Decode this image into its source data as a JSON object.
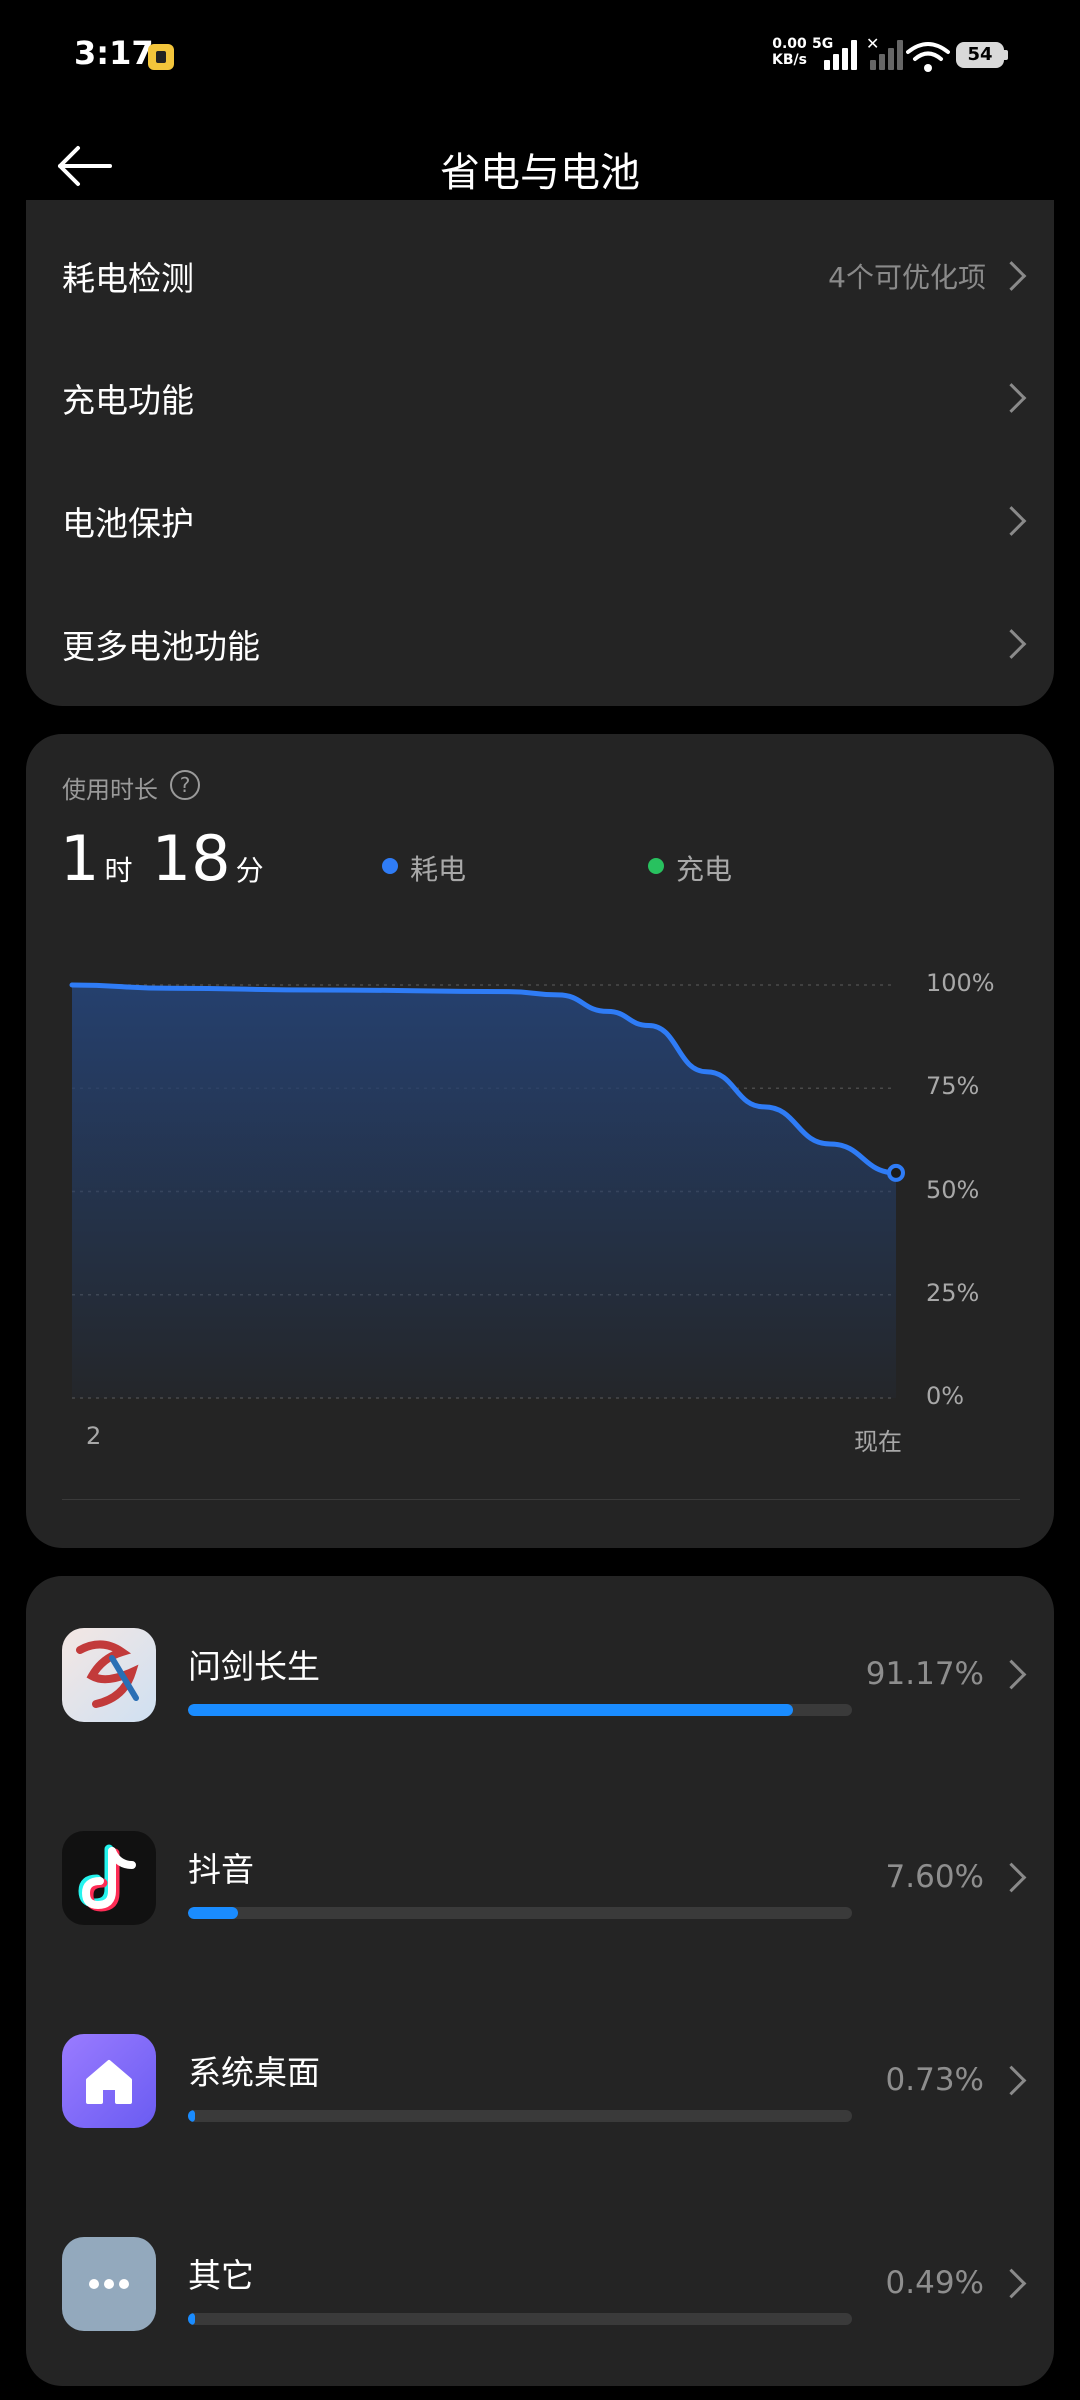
{
  "status": {
    "time": "3:17",
    "net_speed_value": "0.00",
    "net_speed_unit": "KB/s",
    "network_type": "5G",
    "battery_level": "54"
  },
  "header": {
    "title": "省电与电池"
  },
  "menu": {
    "items": [
      {
        "label": "耗电检测",
        "value": "4个可优化项"
      },
      {
        "label": "充电功能",
        "value": ""
      },
      {
        "label": "电池保护",
        "value": ""
      },
      {
        "label": "更多电池功能",
        "value": ""
      }
    ]
  },
  "usage": {
    "label": "使用时长",
    "hours": "1",
    "hours_unit": "时",
    "minutes": "18",
    "minutes_unit": "分",
    "legend": [
      {
        "label": "耗电",
        "color": "#2f7cf6"
      },
      {
        "label": "充电",
        "color": "#28c15f"
      }
    ]
  },
  "chart_data": {
    "type": "area",
    "y_ticks": [
      "100%",
      "75%",
      "50%",
      "25%",
      "0%"
    ],
    "x_ticks": [
      "2",
      "现在"
    ],
    "ylim": [
      0,
      100
    ],
    "series": [
      {
        "name": "耗电",
        "x": [
          0,
          0.12,
          0.3,
          0.53,
          0.59,
          0.65,
          0.7,
          0.77,
          0.84,
          0.92,
          1.0
        ],
        "values": [
          100,
          99.2,
          98.8,
          98.4,
          97.6,
          93.6,
          90.2,
          79,
          70.5,
          61.5,
          54.5
        ]
      }
    ],
    "grid": true
  },
  "apps": [
    {
      "name": "问剑长生",
      "percent": "91.17%",
      "fraction": 0.9117,
      "icon": "wenjian-app-icon"
    },
    {
      "name": "抖音",
      "percent": "7.60%",
      "fraction": 0.076,
      "icon": "douyin-app-icon"
    },
    {
      "name": "系统桌面",
      "percent": "0.73%",
      "fraction": 0.0073,
      "icon": "home-app-icon"
    },
    {
      "name": "其它",
      "percent": "0.49%",
      "fraction": 0.0049,
      "icon": "more-dots-icon"
    }
  ]
}
